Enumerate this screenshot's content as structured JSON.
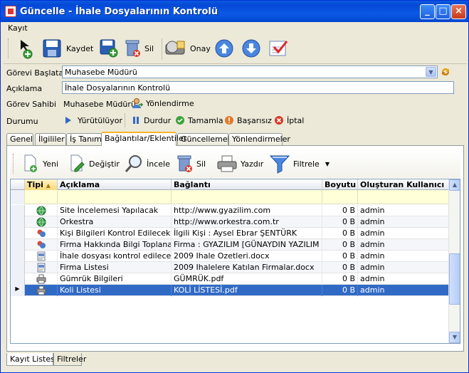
{
  "window": {
    "title": "Güncelle - İhale Dosyalarının Kontrolü"
  },
  "menu": {
    "items": [
      "Kayıt"
    ]
  },
  "toolbar": {
    "save_label": "Kaydet",
    "delete_label": "Sil",
    "approve_label": "Onay"
  },
  "form": {
    "gorevi_baslatan_label": "Görevi Başlatan",
    "gorevi_baslatan_value": "Muhasebe Müdürü",
    "aciklama_label": "Açıklama",
    "aciklama_value": "İhale Dosyalarının Kontrolü",
    "gorev_sahibi_label": "Görev Sahibi",
    "gorev_sahibi_value": "Muhasebe Müdürü",
    "yonlendirme_label": "Yönlendirme",
    "durumu_label": "Durumu",
    "status_buttons": [
      "Yürütülüyor",
      "Durdur",
      "Tamamla",
      "Başarısız",
      "İptal"
    ]
  },
  "tabs": [
    "Genel",
    "İlgililer",
    "İş Tanımı",
    "Bağlantılar/Eklentiler",
    "Güncellemeler",
    "Yönlendirmeler"
  ],
  "active_tab": "Bağlantılar/Eklentiler",
  "panel_toolbar": {
    "new": "Yeni",
    "change": "Değiştir",
    "view": "İncele",
    "delete": "Sil",
    "print": "Yazdır",
    "filter": "Filtrele"
  },
  "grid": {
    "columns": [
      "Tipi",
      "Açıklama",
      "Bağlantı",
      "Boyutu",
      "Oluşturan Kullanıcı"
    ],
    "rows": [
      {
        "icon": "web-link-icon",
        "aciklama": "Site İncelemesi Yapılacak",
        "baglanti": "http://www.gyazilim.com",
        "boyutu": "0 B",
        "kullanici": "admin"
      },
      {
        "icon": "web-link-icon",
        "aciklama": "Orkestra",
        "baglanti": "http://www.orkestra.com.tr",
        "boyutu": "0 B",
        "kullanici": "admin"
      },
      {
        "icon": "contact-icon",
        "aciklama": "Kişi Bilgileri Kontrol Edilecek",
        "baglanti": "İlgili Kişi : Aysel Ebrar ŞENTÜRK",
        "boyutu": "0 B",
        "kullanici": "admin"
      },
      {
        "icon": "contact-icon",
        "aciklama": "Firma Hakkında Bilgi Toplanacak",
        "baglanti": "Firma : GYAZILIM [GÜNAYDIN YAZILIM A.Ş.]",
        "boyutu": "0 B",
        "kullanici": "admin"
      },
      {
        "icon": "document-icon",
        "aciklama": "İhale dosyası kontrol edilecek",
        "baglanti": "2009 Ihale Ozetleri.docx",
        "boyutu": "0 B",
        "kullanici": "admin"
      },
      {
        "icon": "document-icon",
        "aciklama": "Firma Listesi",
        "baglanti": "2009 Ihalelere Katılan Firmalar.docx",
        "boyutu": "0 B",
        "kullanici": "admin"
      },
      {
        "icon": "printer-icon",
        "aciklama": "Gümrük Bilgileri",
        "baglanti": "GÜMRÜK.pdf",
        "boyutu": "0 B",
        "kullanici": "admin"
      },
      {
        "icon": "printer-icon",
        "aciklama": "Koli Listesi",
        "baglanti": "KOLİ LİSTESİ.pdf",
        "boyutu": "0 B",
        "kullanici": "admin"
      }
    ],
    "selected_row": 7
  },
  "bottom_tabs": [
    "Kayıt Listesi",
    "Filtreler"
  ],
  "colors": {
    "titlebar": "#0548d6",
    "selection": "#316ac5",
    "filter_row": "#ffffd8"
  }
}
